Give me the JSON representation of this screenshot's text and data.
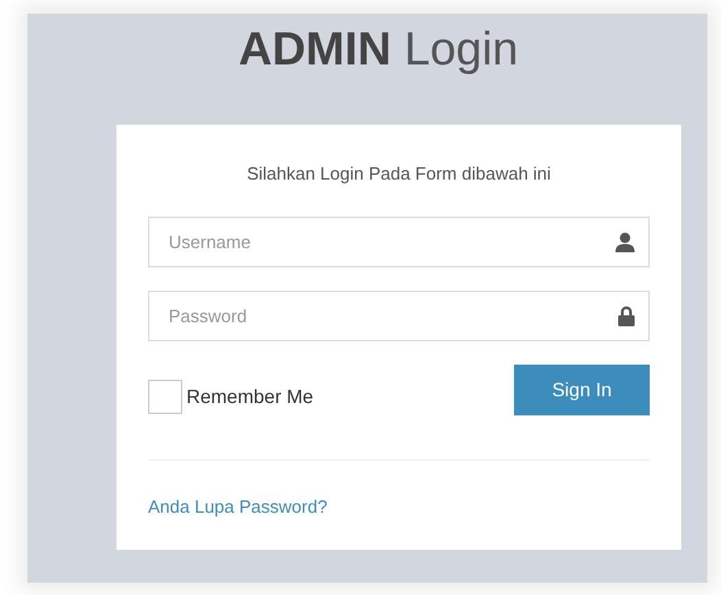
{
  "title": {
    "bold": "ADMIN",
    "light": "Login"
  },
  "card": {
    "message": "Silahkan Login Pada Form dibawah ini",
    "fields": [
      {
        "placeholder": "Username",
        "kind": "user"
      },
      {
        "placeholder": "Password",
        "kind": "lock"
      }
    ],
    "remember": {
      "label": "Remember Me",
      "checked": false
    },
    "submit": "Sign In",
    "forgot_link": "Anda Lupa Password?"
  }
}
